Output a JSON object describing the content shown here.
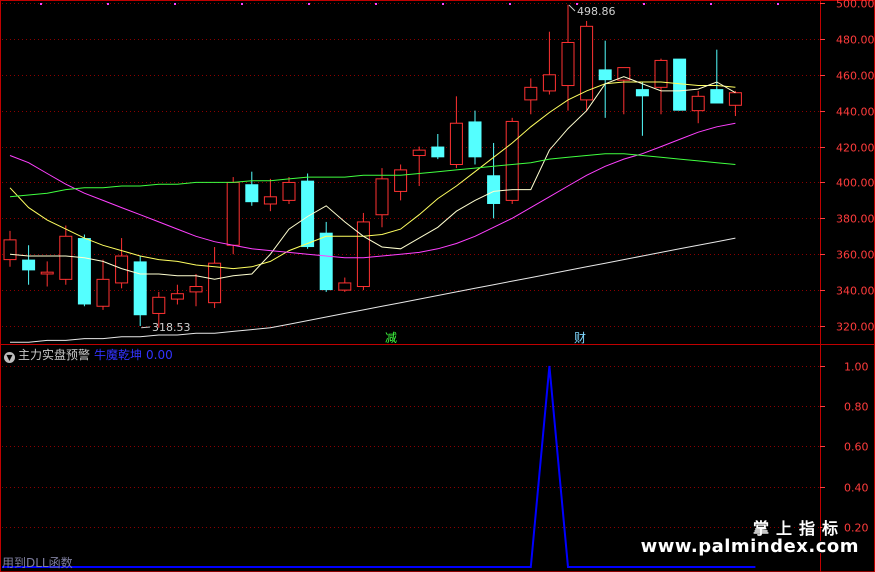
{
  "chart_data": {
    "type": "candlestick",
    "price_axis": {
      "ticks": [
        "500.00",
        "480.00",
        "460.00",
        "440.00",
        "420.00",
        "400.00",
        "380.00",
        "360.00",
        "340.00",
        "320.00"
      ],
      "ylim": [
        313,
        501
      ]
    },
    "candles": [
      {
        "o": 357,
        "h": 373,
        "l": 353,
        "c": 368
      },
      {
        "o": 357,
        "h": 365,
        "l": 343,
        "c": 351
      },
      {
        "o": 349,
        "h": 356,
        "l": 342,
        "c": 350
      },
      {
        "o": 346,
        "h": 376,
        "l": 343,
        "c": 370
      },
      {
        "o": 369,
        "h": 371,
        "l": 331,
        "c": 332
      },
      {
        "o": 331,
        "h": 357,
        "l": 329,
        "c": 346
      },
      {
        "o": 344,
        "h": 369,
        "l": 341,
        "c": 359
      },
      {
        "o": 356,
        "h": 359,
        "l": 320,
        "c": 326
      },
      {
        "o": 327,
        "h": 339,
        "l": 319,
        "c": 336
      },
      {
        "o": 335,
        "h": 343,
        "l": 332,
        "c": 338
      },
      {
        "o": 339,
        "h": 349,
        "l": 331,
        "c": 342
      },
      {
        "o": 333,
        "h": 364,
        "l": 330,
        "c": 355
      },
      {
        "o": 365,
        "h": 403,
        "l": 360,
        "c": 400
      },
      {
        "o": 399,
        "h": 406,
        "l": 387,
        "c": 389
      },
      {
        "o": 388,
        "h": 402,
        "l": 384,
        "c": 392
      },
      {
        "o": 390,
        "h": 403,
        "l": 388,
        "c": 400
      },
      {
        "o": 401,
        "h": 405,
        "l": 363,
        "c": 364
      },
      {
        "o": 372,
        "h": 378,
        "l": 339,
        "c": 340
      },
      {
        "o": 340,
        "h": 347,
        "l": 339,
        "c": 344
      },
      {
        "o": 342,
        "h": 383,
        "l": 340,
        "c": 378
      },
      {
        "o": 382,
        "h": 408,
        "l": 375,
        "c": 402
      },
      {
        "o": 395,
        "h": 410,
        "l": 390,
        "c": 407
      },
      {
        "o": 415,
        "h": 420,
        "l": 398,
        "c": 418
      },
      {
        "o": 420,
        "h": 427,
        "l": 413,
        "c": 414
      },
      {
        "o": 410,
        "h": 448,
        "l": 408,
        "c": 433
      },
      {
        "o": 434,
        "h": 440,
        "l": 410,
        "c": 414
      },
      {
        "o": 404,
        "h": 422,
        "l": 380,
        "c": 388
      },
      {
        "o": 390,
        "h": 436,
        "l": 388,
        "c": 434
      },
      {
        "o": 446,
        "h": 458,
        "l": 438,
        "c": 453
      },
      {
        "o": 451,
        "h": 484,
        "l": 449,
        "c": 460
      },
      {
        "o": 454,
        "h": 499,
        "l": 440,
        "c": 478
      },
      {
        "o": 446,
        "h": 490,
        "l": 440,
        "c": 487
      },
      {
        "o": 463,
        "h": 479,
        "l": 436,
        "c": 457
      },
      {
        "o": 457,
        "h": 464,
        "l": 438,
        "c": 464
      },
      {
        "o": 452,
        "h": 456,
        "l": 426,
        "c": 448
      },
      {
        "o": 453,
        "h": 469,
        "l": 438,
        "c": 468
      },
      {
        "o": 469,
        "h": 466,
        "l": 440,
        "c": 440
      },
      {
        "o": 440,
        "h": 451,
        "l": 433,
        "c": 448
      },
      {
        "o": 452,
        "h": 474,
        "l": 446,
        "c": 444
      },
      {
        "o": 443,
        "h": 451,
        "l": 437,
        "c": 450
      }
    ],
    "bull_color": "#ff3232",
    "bear_color": "#54ffff",
    "moving_averages": [
      {
        "color": "#ffff60",
        "values": [
          397,
          386,
          379,
          374,
          369,
          365,
          362,
          359,
          357,
          356,
          354,
          353,
          352,
          353,
          356,
          362,
          366,
          370,
          370,
          370,
          371,
          374,
          382,
          391,
          398,
          406,
          414,
          422,
          431,
          439,
          446,
          451,
          455,
          456,
          456,
          456,
          455,
          454,
          454,
          453
        ]
      },
      {
        "color": "#ffffd0",
        "values": [
          360,
          359,
          359,
          359,
          358,
          356,
          352,
          349,
          349,
          348,
          348,
          346,
          348,
          349,
          360,
          374,
          381,
          387,
          378,
          370,
          364,
          363,
          369,
          375,
          384,
          390,
          395,
          396,
          396,
          418,
          430,
          440,
          455,
          459,
          455,
          451,
          451,
          452,
          456,
          450
        ]
      },
      {
        "color": "#ff40ff",
        "values": [
          415,
          411,
          405,
          399,
          394,
          390,
          386,
          382,
          378,
          374,
          370,
          367,
          365,
          363,
          362,
          361,
          360,
          359,
          358,
          358,
          359,
          360,
          361,
          363,
          366,
          370,
          375,
          380,
          386,
          392,
          398,
          404,
          409,
          413,
          416,
          420,
          424,
          428,
          431,
          433
        ]
      },
      {
        "color": "#40ff40",
        "values": [
          392,
          393,
          394,
          396,
          397,
          397,
          398,
          398,
          399,
          399,
          400,
          400,
          400,
          401,
          401,
          402,
          403,
          403,
          403,
          404,
          404,
          404,
          405,
          406,
          407,
          408,
          409,
          410,
          411,
          413,
          414,
          415,
          416,
          416,
          415,
          414,
          413,
          412,
          411,
          410
        ]
      },
      {
        "color": "#e8e8e8",
        "values": [
          311,
          311,
          312,
          312,
          313,
          313,
          314,
          314,
          315,
          315,
          316,
          316,
          317,
          318,
          319,
          321,
          323,
          325,
          327,
          329,
          331,
          333,
          335,
          337,
          339,
          341,
          343,
          345,
          347,
          349,
          351,
          353,
          355,
          357,
          359,
          361,
          363,
          365,
          367,
          369
        ]
      }
    ],
    "annotations": {
      "high": "498.86",
      "low": "318.53",
      "marks": [
        "减",
        "财"
      ]
    },
    "indicator": {
      "title": "主力实盘预警",
      "series_name": "牛魔乾坤",
      "current_value": "0.00",
      "ticks": [
        "1.00",
        "0.80",
        "0.60",
        "0.40",
        "0.20"
      ],
      "ylim": [
        0,
        1.05
      ],
      "color": "#0000ff",
      "values": [
        0,
        0,
        0,
        0,
        0,
        0,
        0,
        0,
        0,
        0,
        0,
        0,
        0,
        0,
        0,
        0,
        0,
        0,
        0,
        0,
        0,
        0,
        0,
        0,
        0,
        0,
        0,
        0,
        0,
        1,
        0,
        0,
        0,
        0,
        0,
        0,
        0,
        0,
        0,
        0
      ]
    }
  },
  "footer": "用到DLL函数",
  "watermark": {
    "line1": "掌上指标",
    "line2": "www.palmindex.com"
  },
  "colors": {
    "grid": "#8b0000",
    "axis_text": "#ff3c3c",
    "background": "#000000"
  }
}
